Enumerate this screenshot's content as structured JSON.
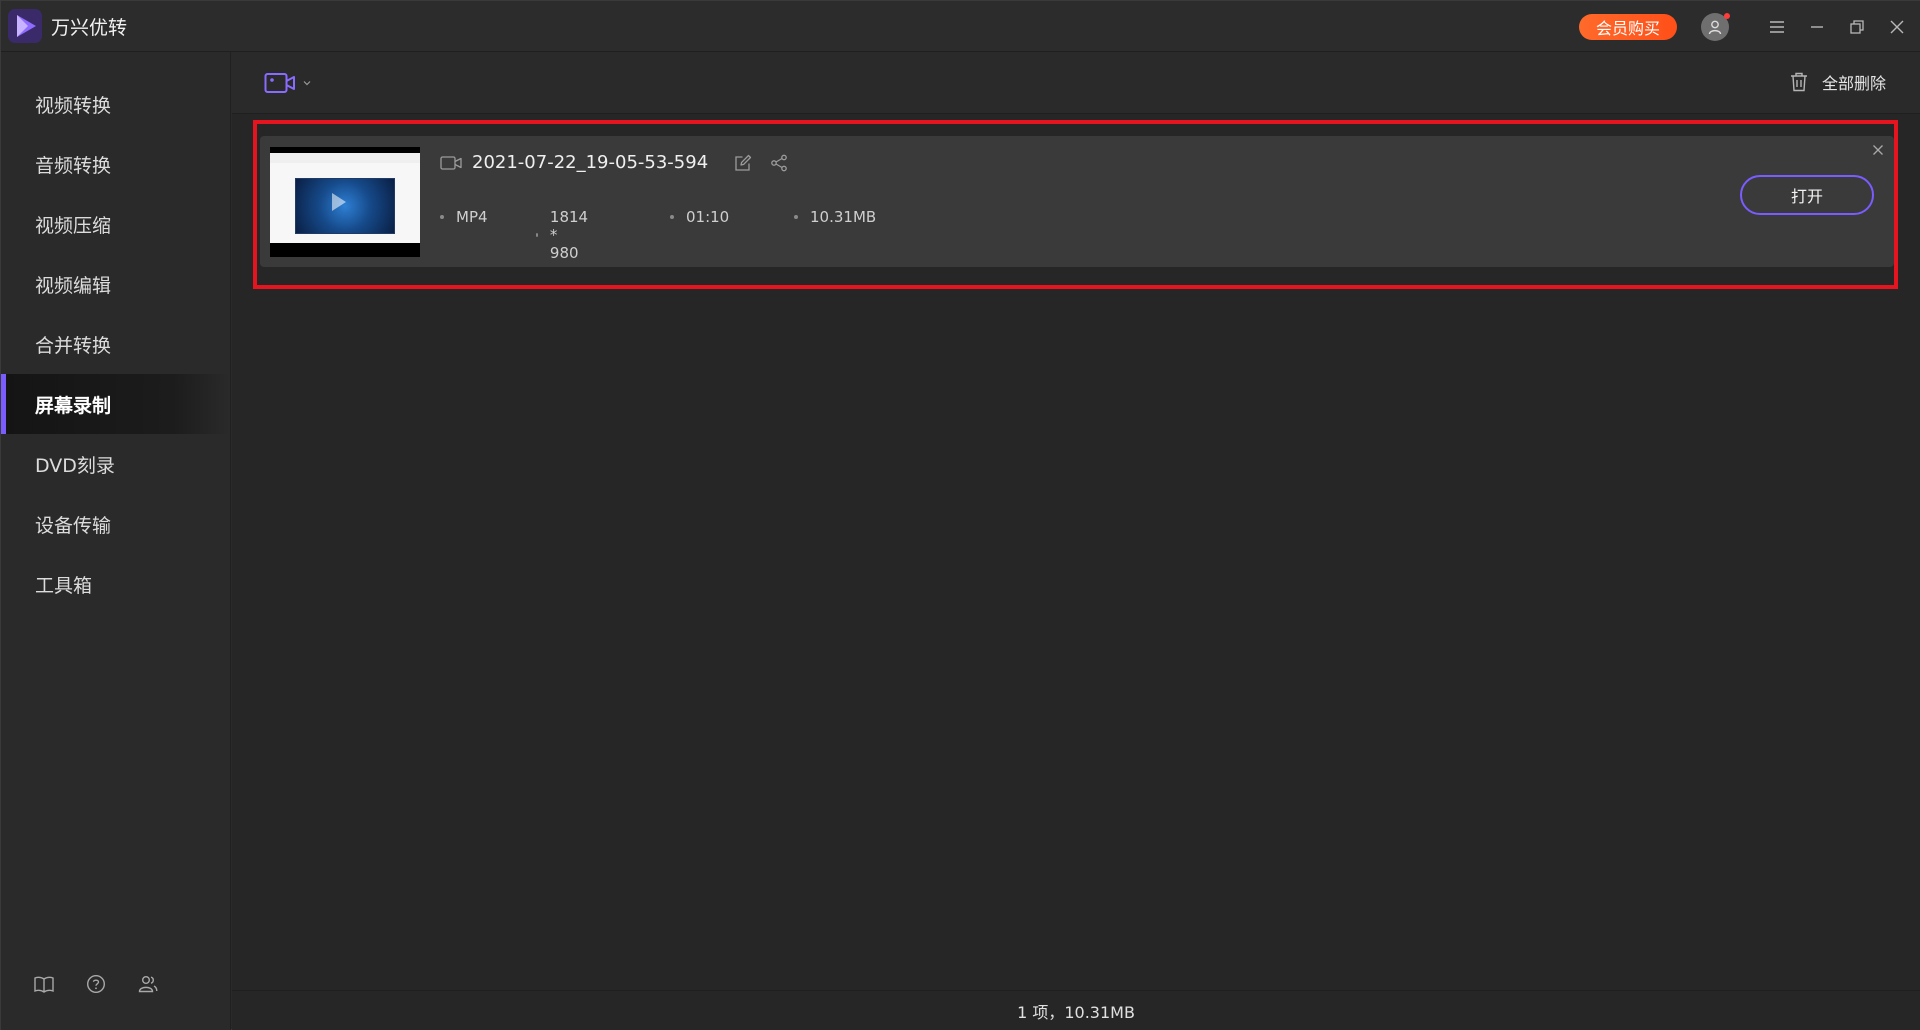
{
  "app": {
    "title": "万兴优转",
    "brand_color": "#7b5cff"
  },
  "titlebar": {
    "vip_label": "会员购买",
    "icons": [
      "avatar-icon",
      "menu-icon",
      "minimize-icon",
      "restore-icon",
      "close-icon"
    ]
  },
  "sidebar": {
    "items": [
      {
        "label": "视频转换",
        "active": false
      },
      {
        "label": "音频转换",
        "active": false
      },
      {
        "label": "视频压缩",
        "active": false
      },
      {
        "label": "视频编辑",
        "active": false
      },
      {
        "label": "合并转换",
        "active": false
      },
      {
        "label": "屏幕录制",
        "active": true
      },
      {
        "label": "DVD刻录",
        "active": false
      },
      {
        "label": "设备传输",
        "active": false
      },
      {
        "label": "工具箱",
        "active": false
      }
    ],
    "footer_icons": [
      "book-icon",
      "help-icon",
      "users-icon"
    ]
  },
  "toolbar": {
    "record_icon": "video-camera-icon",
    "delete_all_label": "全部删除"
  },
  "files": [
    {
      "name": "2021-07-22_19-05-53-594",
      "format": "MP4",
      "resolution": "1814 * 980",
      "duration": "01:10",
      "size": "10.31MB",
      "open_label": "打开"
    }
  ],
  "status": {
    "summary": "1 项，10.31MB"
  }
}
